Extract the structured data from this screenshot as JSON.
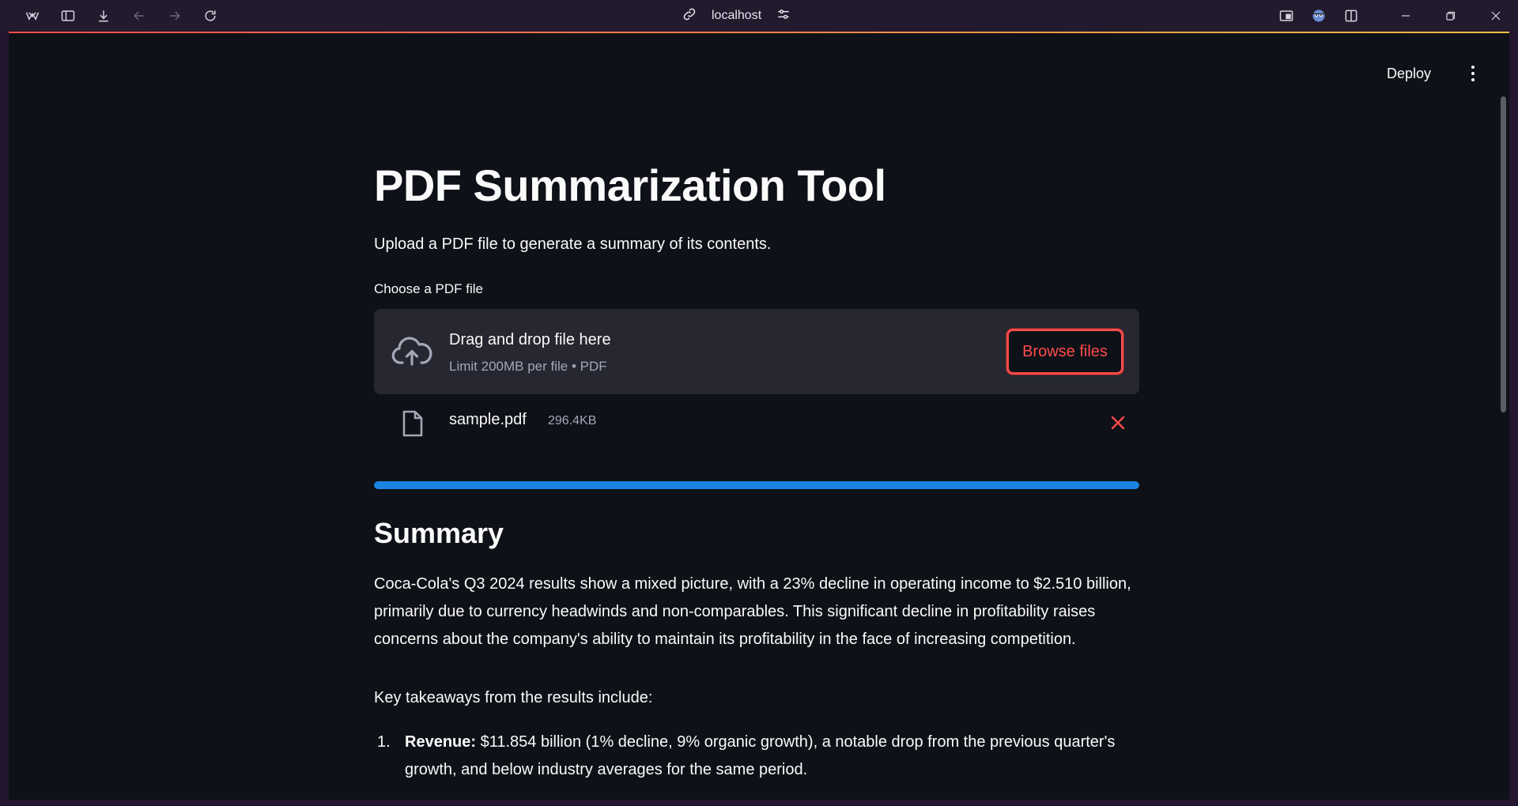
{
  "browser": {
    "address": "localhost",
    "icons": [
      "app-logo-icon",
      "sidebar-icon",
      "download-icon",
      "back-icon",
      "forward-icon",
      "reload-icon",
      "link-icon",
      "site-settings-icon",
      "reader-icon",
      "extension-icon",
      "split-view-icon",
      "minimize-icon",
      "restore-icon",
      "close-icon"
    ]
  },
  "header": {
    "deploy_label": "Deploy"
  },
  "main": {
    "title": "PDF Summarization Tool",
    "subtitle": "Upload a PDF file to generate a summary of its contents.",
    "uploader": {
      "label": "Choose a PDF file",
      "drop_title": "Drag and drop file here",
      "limit_text": "Limit 200MB per file • PDF",
      "browse_label": "Browse files"
    },
    "file": {
      "name": "sample.pdf",
      "size": "296.4KB"
    },
    "progress": 1.0,
    "summary": {
      "heading": "Summary",
      "paragraph": "Coca-Cola's Q3 2024 results show a mixed picture, with a 23% decline in operating income to $2.510 billion, primarily due to currency headwinds and non-comparables. This significant decline in profitability raises concerns about the company's ability to maintain its profitability in the face of increasing competition.",
      "takeaways_intro": "Key takeaways from the results include:",
      "items": [
        {
          "number": "1.",
          "label": "Revenue:",
          "text": " $11.854 billion (1% decline, 9% organic growth), a notable drop from the previous quarter's growth, and below industry averages for the same period."
        }
      ]
    }
  },
  "colors": {
    "accent": "#ff4b4b",
    "progress": "#1c83e1",
    "background": "#0e1117",
    "panel": "#262730"
  }
}
